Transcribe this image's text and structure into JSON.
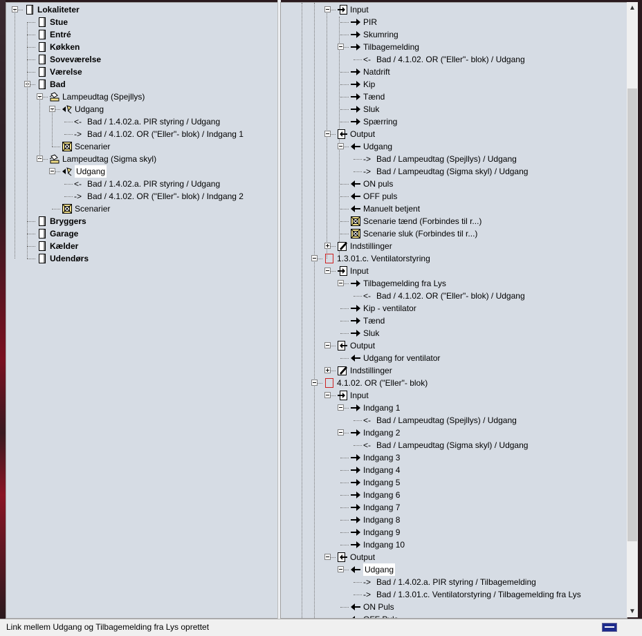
{
  "left_tree": [
    {
      "label": "Lokaliteter",
      "indent": 0,
      "icon": "page-icon",
      "bold": true,
      "expander": "minus"
    },
    {
      "label": "Stue",
      "indent": 1,
      "icon": "page-icon",
      "bold": true
    },
    {
      "label": "Entré",
      "indent": 1,
      "icon": "page-icon",
      "bold": true
    },
    {
      "label": "Køkken",
      "indent": 1,
      "icon": "page-icon",
      "bold": true
    },
    {
      "label": "Soveværelse",
      "indent": 1,
      "icon": "page-icon",
      "bold": true
    },
    {
      "label": "Værelse",
      "indent": 1,
      "icon": "page-icon",
      "bold": true
    },
    {
      "label": "Bad",
      "indent": 1,
      "icon": "page-icon",
      "bold": true,
      "expander": "minus"
    },
    {
      "label": "Lampeudtag (Spejllys)",
      "indent": 2,
      "icon": "lamp-icon",
      "expander": "minus"
    },
    {
      "label": "Udgang",
      "indent": 3,
      "icon": "output-lamp-icon",
      "expander": "minus"
    },
    {
      "label": "Bad / 1.4.02.a. PIR styring  / Udgang",
      "indent": 4,
      "arrow": "<-"
    },
    {
      "label": "Bad / 4.1.02. OR (\"Eller\"- blok) / Indgang 1",
      "indent": 4,
      "arrow": "->"
    },
    {
      "label": "Scenarier",
      "indent": 3,
      "icon": "scene-icon"
    },
    {
      "label": "Lampeudtag (Sigma skyl)",
      "indent": 2,
      "icon": "lamp-icon",
      "expander": "minus"
    },
    {
      "label": "Udgang",
      "indent": 3,
      "icon": "output-lamp-icon",
      "expander": "minus",
      "selected": true
    },
    {
      "label": "Bad / 1.4.02.a. PIR styring  / Udgang",
      "indent": 4,
      "arrow": "<-"
    },
    {
      "label": "Bad / 4.1.02. OR (\"Eller\"- blok) / Indgang 2",
      "indent": 4,
      "arrow": "->"
    },
    {
      "label": "Scenarier",
      "indent": 3,
      "icon": "scene-icon"
    },
    {
      "label": "Bryggers",
      "indent": 1,
      "icon": "page-icon",
      "bold": true
    },
    {
      "label": "Garage",
      "indent": 1,
      "icon": "page-icon",
      "bold": true
    },
    {
      "label": "Kælder",
      "indent": 1,
      "icon": "page-icon",
      "bold": true
    },
    {
      "label": "Udendørs",
      "indent": 1,
      "icon": "page-icon",
      "bold": true
    }
  ],
  "right_tree": [
    {
      "label": "Input",
      "indent": 1,
      "icon": "input-icon",
      "expander": "minus"
    },
    {
      "label": "PIR",
      "indent": 2,
      "icon": "arrow-right-icon"
    },
    {
      "label": "Skumring",
      "indent": 2,
      "icon": "arrow-right-icon"
    },
    {
      "label": "Tilbagemelding",
      "indent": 2,
      "icon": "arrow-right-icon",
      "expander": "minus"
    },
    {
      "label": "Bad / 4.1.02. OR (\"Eller\"- blok) / Udgang",
      "indent": 3,
      "arrow": "<-"
    },
    {
      "label": "Natdrift",
      "indent": 2,
      "icon": "arrow-right-icon"
    },
    {
      "label": "Kip",
      "indent": 2,
      "icon": "arrow-right-icon"
    },
    {
      "label": "Tænd",
      "indent": 2,
      "icon": "arrow-right-icon"
    },
    {
      "label": "Sluk",
      "indent": 2,
      "icon": "arrow-right-icon"
    },
    {
      "label": "Spærring",
      "indent": 2,
      "icon": "arrow-right-icon"
    },
    {
      "label": "Output",
      "indent": 1,
      "icon": "output-icon",
      "expander": "minus"
    },
    {
      "label": "Udgang",
      "indent": 2,
      "icon": "arrow-left-icon",
      "expander": "minus"
    },
    {
      "label": "Bad / Lampeudtag (Spejllys)  / Udgang",
      "indent": 3,
      "arrow": "->"
    },
    {
      "label": "Bad / Lampeudtag (Sigma skyl)  / Udgang",
      "indent": 3,
      "arrow": "->"
    },
    {
      "label": "ON puls",
      "indent": 2,
      "icon": "arrow-left-icon"
    },
    {
      "label": "OFF puls",
      "indent": 2,
      "icon": "arrow-left-icon"
    },
    {
      "label": "Manuelt betjent",
      "indent": 2,
      "icon": "arrow-left-icon"
    },
    {
      "label": "Scenarie tænd (Forbindes til r...)",
      "indent": 2,
      "icon": "scene-icon"
    },
    {
      "label": "Scenarie sluk (Forbindes til r...)",
      "indent": 2,
      "icon": "scene-icon"
    },
    {
      "label": "Indstillinger",
      "indent": 1,
      "icon": "settings-icon",
      "expander": "plus"
    },
    {
      "label": "1.3.01.c. Ventilatorstyring",
      "indent": 0,
      "icon": "module-icon",
      "expander": "minus"
    },
    {
      "label": "Input",
      "indent": 1,
      "icon": "input-icon",
      "expander": "minus"
    },
    {
      "label": "Tilbagemelding fra Lys",
      "indent": 2,
      "icon": "arrow-right-icon",
      "expander": "minus"
    },
    {
      "label": "Bad / 4.1.02. OR (\"Eller\"- blok) / Udgang",
      "indent": 3,
      "arrow": "<-"
    },
    {
      "label": "Kip - ventilator",
      "indent": 2,
      "icon": "arrow-right-icon"
    },
    {
      "label": "Tænd",
      "indent": 2,
      "icon": "arrow-right-icon"
    },
    {
      "label": "Sluk",
      "indent": 2,
      "icon": "arrow-right-icon"
    },
    {
      "label": "Output",
      "indent": 1,
      "icon": "output-icon",
      "expander": "minus"
    },
    {
      "label": "Udgang for ventilator",
      "indent": 2,
      "icon": "arrow-left-icon"
    },
    {
      "label": "Indstillinger",
      "indent": 1,
      "icon": "settings-icon",
      "expander": "plus"
    },
    {
      "label": "4.1.02. OR (\"Eller\"- blok)",
      "indent": 0,
      "icon": "module-icon",
      "expander": "minus"
    },
    {
      "label": "Input",
      "indent": 1,
      "icon": "input-icon",
      "expander": "minus"
    },
    {
      "label": "Indgang 1",
      "indent": 2,
      "icon": "arrow-right-icon",
      "expander": "minus"
    },
    {
      "label": "Bad / Lampeudtag (Spejllys)  / Udgang",
      "indent": 3,
      "arrow": "<-"
    },
    {
      "label": "Indgang 2",
      "indent": 2,
      "icon": "arrow-right-icon",
      "expander": "minus"
    },
    {
      "label": "Bad / Lampeudtag (Sigma skyl)  / Udgang",
      "indent": 3,
      "arrow": "<-"
    },
    {
      "label": "Indgang 3",
      "indent": 2,
      "icon": "arrow-right-icon"
    },
    {
      "label": "Indgang 4",
      "indent": 2,
      "icon": "arrow-right-icon"
    },
    {
      "label": "Indgang 5",
      "indent": 2,
      "icon": "arrow-right-icon"
    },
    {
      "label": "Indgang 6",
      "indent": 2,
      "icon": "arrow-right-icon"
    },
    {
      "label": "Indgang 7",
      "indent": 2,
      "icon": "arrow-right-icon"
    },
    {
      "label": "Indgang 8",
      "indent": 2,
      "icon": "arrow-right-icon"
    },
    {
      "label": "Indgang 9",
      "indent": 2,
      "icon": "arrow-right-icon"
    },
    {
      "label": "Indgang 10",
      "indent": 2,
      "icon": "arrow-right-icon"
    },
    {
      "label": "Output",
      "indent": 1,
      "icon": "output-icon",
      "expander": "minus"
    },
    {
      "label": "Udgang",
      "indent": 2,
      "icon": "arrow-left-icon",
      "expander": "minus",
      "selected": true
    },
    {
      "label": "Bad / 1.4.02.a. PIR styring  / Tilbagemelding",
      "indent": 3,
      "arrow": "->"
    },
    {
      "label": "Bad / 1.3.01.c. Ventilatorstyring  / Tilbagemelding fra Lys",
      "indent": 3,
      "arrow": "->"
    },
    {
      "label": "ON Puls",
      "indent": 2,
      "icon": "arrow-left-icon"
    },
    {
      "label": "OFF Puls",
      "indent": 2,
      "icon": "arrow-left-icon"
    }
  ],
  "statusbar": {
    "text": "Link mellem Udgang og Tilbagemelding fra Lys oprettet"
  },
  "colors": {
    "pane_bg": "#d6dce4",
    "module_icon_border": "#cc2020",
    "status_indicator": "#1c2a8c"
  }
}
